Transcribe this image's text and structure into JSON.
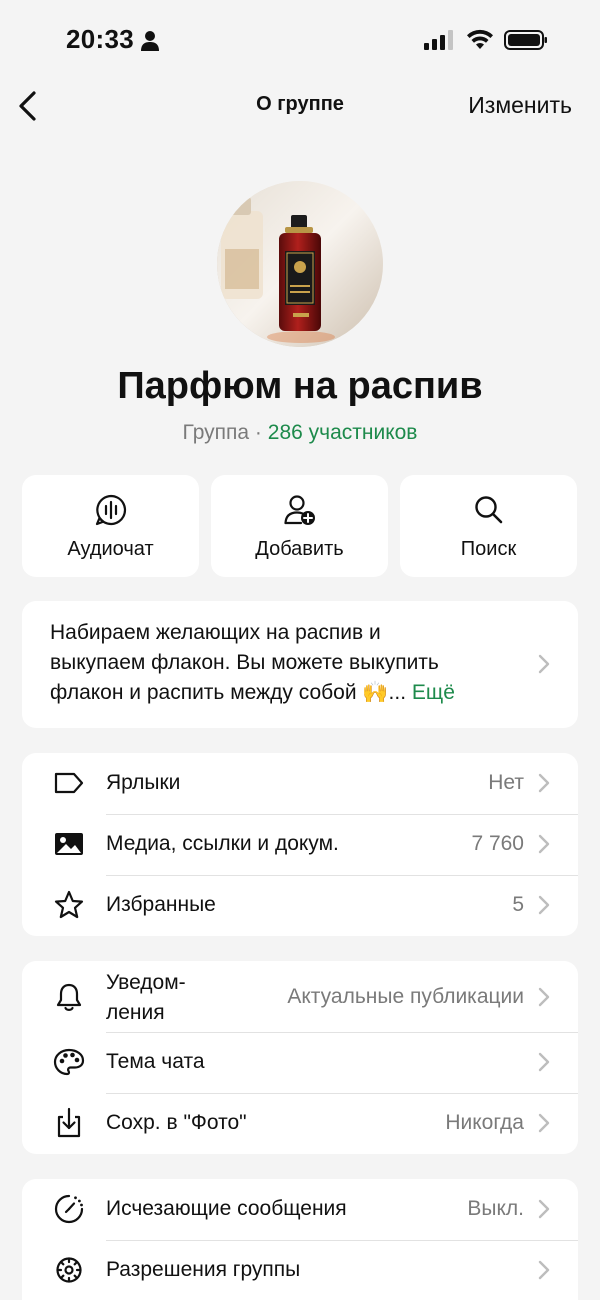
{
  "status_bar": {
    "time": "20:33"
  },
  "nav": {
    "title": "О группе",
    "edit_label": "Изменить"
  },
  "group": {
    "name": "Парфюм на распив",
    "type": "Группа",
    "separator": "·",
    "members": "286 участников"
  },
  "actions": [
    {
      "label": "Аудиочат",
      "icon": "audio-chat-icon"
    },
    {
      "label": "Добавить",
      "icon": "add-person-icon"
    },
    {
      "label": "Поиск",
      "icon": "search-icon"
    }
  ],
  "description": {
    "line1": "Набираем желающих на распив и",
    "line2": "выкупаем флакон. Вы можете выкупить",
    "line3": "флакон и распить между собой 🙌...",
    "more_label": "Ещё"
  },
  "section1": [
    {
      "label": "Ярлыки",
      "value": "Нет",
      "icon": "tag-icon"
    },
    {
      "label": "Медиа, ссылки и докум.",
      "value": "7 760",
      "icon": "image-icon"
    },
    {
      "label": "Избранные",
      "value": "5",
      "icon": "star-icon"
    }
  ],
  "section2": [
    {
      "label_line1": "Уведом-",
      "label_line2": "ления",
      "value": "Актуальные публикации",
      "icon": "bell-icon"
    },
    {
      "label": "Тема чата",
      "value": "",
      "icon": "palette-icon"
    },
    {
      "label": "Сохр. в \"Фото\"",
      "value": "Никогда",
      "icon": "save-download-icon"
    }
  ],
  "section3": [
    {
      "label": "Исчезающие сообщения",
      "value": "Выкл.",
      "icon": "disappearing-timer-icon"
    },
    {
      "label": "Разрешения группы",
      "value": "",
      "icon": "gear-icon"
    }
  ],
  "colors": {
    "accent_green": "#1d8a4b",
    "background": "#f4f4f4",
    "card": "#ffffff",
    "secondary_text": "#7a7a7a"
  }
}
